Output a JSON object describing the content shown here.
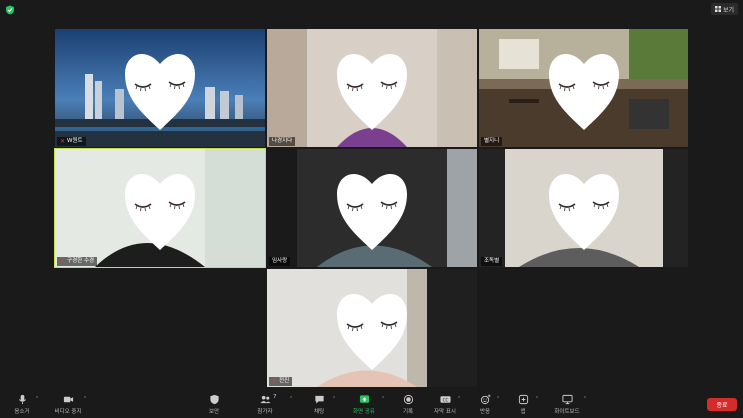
{
  "top_bar": {
    "view_label": "보기"
  },
  "participants": [
    {
      "name": "W원트",
      "muted": true
    },
    {
      "name": "나경지다",
      "muted": false
    },
    {
      "name": "별지니",
      "muted": false
    },
    {
      "name": "구경한 수경",
      "muted": true,
      "active": true
    },
    {
      "name": "임사랑",
      "muted": false
    },
    {
      "name": "조독별",
      "muted": false
    },
    {
      "name": "전진",
      "muted": true
    }
  ],
  "toolbar": {
    "mute_label": "음소거",
    "video_label": "비디오 중지",
    "security_label": "보안",
    "participants_label": "참가자",
    "participants_count": "7",
    "chat_label": "채팅",
    "share_label": "화면 공유",
    "record_label": "기록",
    "caption_label": "자막 표시",
    "reactions_label": "반응",
    "apps_label": "앱",
    "whiteboard_label": "화이트보드",
    "end_label": "종료"
  },
  "colors": {
    "share_accent": "#22c55e",
    "end_button": "#d52b2b",
    "active_border": "#c7e04a",
    "muted_mic": "#e03c31"
  }
}
